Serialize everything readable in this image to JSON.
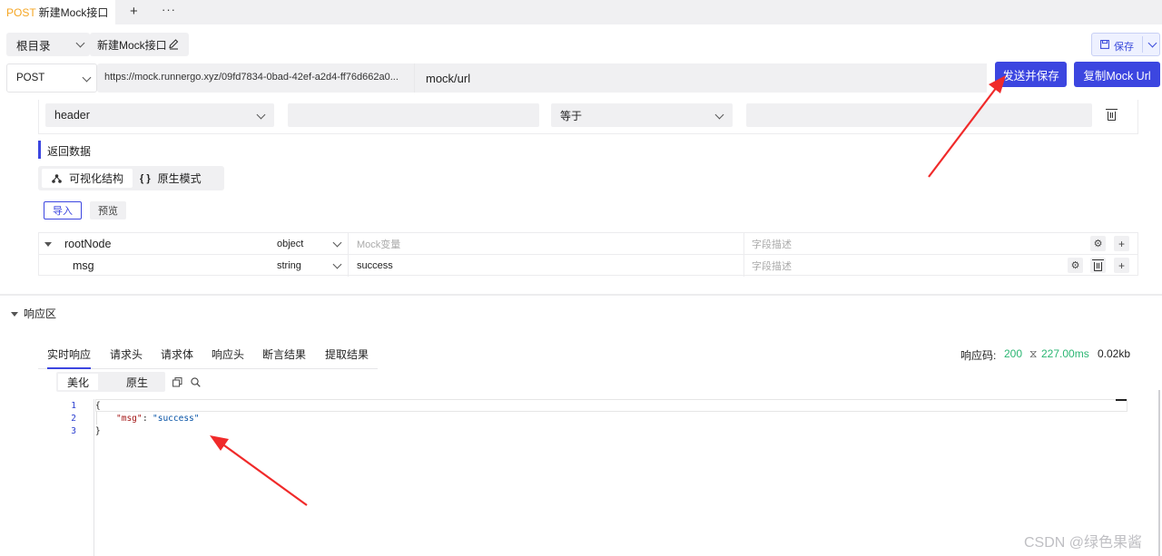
{
  "tab": {
    "method": "POST",
    "title": "新建Mock接口",
    "plus": "+",
    "more": "···"
  },
  "toolbar": {
    "dir": "根目录",
    "name": "新建Mock接口",
    "save": "保存"
  },
  "request": {
    "method": "POST",
    "url": "https://mock.runnergo.xyz/09fd7834-0bad-42ef-a2d4-ff76d662a0...",
    "path": "mock/url",
    "send_save_btn": "发送并保存",
    "copy_btn": "复制Mock Url"
  },
  "condition": {
    "source": "header",
    "operator": "等于"
  },
  "return_section": {
    "title": "返回数据",
    "mode_visual": "可视化结构",
    "mode_raw": "原生模式",
    "import_btn": "导入",
    "preview_btn": "预览",
    "rows": [
      {
        "name": "rootNode",
        "type": "object",
        "value_placeholder": "Mock变量",
        "desc_placeholder": "字段描述"
      },
      {
        "name": "msg",
        "type": "string",
        "value": "success",
        "desc_placeholder": "字段描述"
      }
    ]
  },
  "response": {
    "title": "响应区",
    "tabs": [
      "实时响应",
      "请求头",
      "请求体",
      "响应头",
      "断言结果",
      "提取结果"
    ],
    "status_label": "响应码:",
    "status_code": "200",
    "time": "227.00ms",
    "size": "0.02kb",
    "view_beautify": "美化",
    "view_raw": "原生",
    "lines": [
      "1",
      "2",
      "3"
    ],
    "code_open": "{",
    "code_key": "\"msg\"",
    "code_colon": ": ",
    "code_value": "\"success\"",
    "code_close": "}"
  },
  "watermark": "CSDN @绿色果酱",
  "colors": {
    "accent": "#3c46e0",
    "method_orange": "#f5a623",
    "status_green": "#2bb673",
    "arrow_red": "#f02a2a"
  }
}
